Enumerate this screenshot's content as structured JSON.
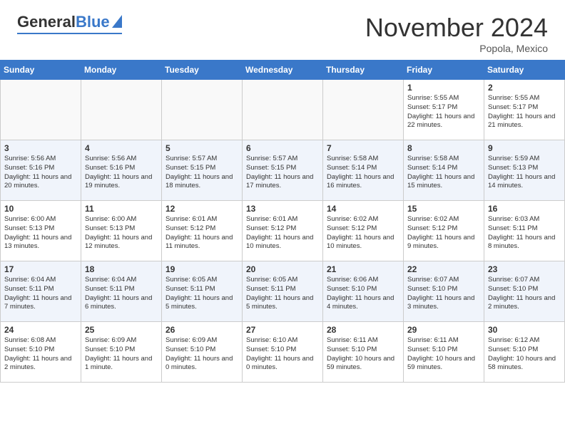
{
  "header": {
    "logo": {
      "general": "General",
      "blue": "Blue"
    },
    "title": "November 2024",
    "subtitle": "Popola, Mexico"
  },
  "weekdays": [
    "Sunday",
    "Monday",
    "Tuesday",
    "Wednesday",
    "Thursday",
    "Friday",
    "Saturday"
  ],
  "weeks": [
    [
      {
        "day": "",
        "empty": true
      },
      {
        "day": "",
        "empty": true
      },
      {
        "day": "",
        "empty": true
      },
      {
        "day": "",
        "empty": true
      },
      {
        "day": "",
        "empty": true
      },
      {
        "day": "1",
        "sunrise": "5:55 AM",
        "sunset": "5:17 PM",
        "daylight": "11 hours and 22 minutes."
      },
      {
        "day": "2",
        "sunrise": "5:55 AM",
        "sunset": "5:17 PM",
        "daylight": "11 hours and 21 minutes."
      }
    ],
    [
      {
        "day": "3",
        "sunrise": "5:56 AM",
        "sunset": "5:16 PM",
        "daylight": "11 hours and 20 minutes."
      },
      {
        "day": "4",
        "sunrise": "5:56 AM",
        "sunset": "5:16 PM",
        "daylight": "11 hours and 19 minutes."
      },
      {
        "day": "5",
        "sunrise": "5:57 AM",
        "sunset": "5:15 PM",
        "daylight": "11 hours and 18 minutes."
      },
      {
        "day": "6",
        "sunrise": "5:57 AM",
        "sunset": "5:15 PM",
        "daylight": "11 hours and 17 minutes."
      },
      {
        "day": "7",
        "sunrise": "5:58 AM",
        "sunset": "5:14 PM",
        "daylight": "11 hours and 16 minutes."
      },
      {
        "day": "8",
        "sunrise": "5:58 AM",
        "sunset": "5:14 PM",
        "daylight": "11 hours and 15 minutes."
      },
      {
        "day": "9",
        "sunrise": "5:59 AM",
        "sunset": "5:13 PM",
        "daylight": "11 hours and 14 minutes."
      }
    ],
    [
      {
        "day": "10",
        "sunrise": "6:00 AM",
        "sunset": "5:13 PM",
        "daylight": "11 hours and 13 minutes."
      },
      {
        "day": "11",
        "sunrise": "6:00 AM",
        "sunset": "5:13 PM",
        "daylight": "11 hours and 12 minutes."
      },
      {
        "day": "12",
        "sunrise": "6:01 AM",
        "sunset": "5:12 PM",
        "daylight": "11 hours and 11 minutes."
      },
      {
        "day": "13",
        "sunrise": "6:01 AM",
        "sunset": "5:12 PM",
        "daylight": "11 hours and 10 minutes."
      },
      {
        "day": "14",
        "sunrise": "6:02 AM",
        "sunset": "5:12 PM",
        "daylight": "11 hours and 10 minutes."
      },
      {
        "day": "15",
        "sunrise": "6:02 AM",
        "sunset": "5:12 PM",
        "daylight": "11 hours and 9 minutes."
      },
      {
        "day": "16",
        "sunrise": "6:03 AM",
        "sunset": "5:11 PM",
        "daylight": "11 hours and 8 minutes."
      }
    ],
    [
      {
        "day": "17",
        "sunrise": "6:04 AM",
        "sunset": "5:11 PM",
        "daylight": "11 hours and 7 minutes."
      },
      {
        "day": "18",
        "sunrise": "6:04 AM",
        "sunset": "5:11 PM",
        "daylight": "11 hours and 6 minutes."
      },
      {
        "day": "19",
        "sunrise": "6:05 AM",
        "sunset": "5:11 PM",
        "daylight": "11 hours and 5 minutes."
      },
      {
        "day": "20",
        "sunrise": "6:05 AM",
        "sunset": "5:11 PM",
        "daylight": "11 hours and 5 minutes."
      },
      {
        "day": "21",
        "sunrise": "6:06 AM",
        "sunset": "5:10 PM",
        "daylight": "11 hours and 4 minutes."
      },
      {
        "day": "22",
        "sunrise": "6:07 AM",
        "sunset": "5:10 PM",
        "daylight": "11 hours and 3 minutes."
      },
      {
        "day": "23",
        "sunrise": "6:07 AM",
        "sunset": "5:10 PM",
        "daylight": "11 hours and 2 minutes."
      }
    ],
    [
      {
        "day": "24",
        "sunrise": "6:08 AM",
        "sunset": "5:10 PM",
        "daylight": "11 hours and 2 minutes."
      },
      {
        "day": "25",
        "sunrise": "6:09 AM",
        "sunset": "5:10 PM",
        "daylight": "11 hours and 1 minute."
      },
      {
        "day": "26",
        "sunrise": "6:09 AM",
        "sunset": "5:10 PM",
        "daylight": "11 hours and 0 minutes."
      },
      {
        "day": "27",
        "sunrise": "6:10 AM",
        "sunset": "5:10 PM",
        "daylight": "11 hours and 0 minutes."
      },
      {
        "day": "28",
        "sunrise": "6:11 AM",
        "sunset": "5:10 PM",
        "daylight": "10 hours and 59 minutes."
      },
      {
        "day": "29",
        "sunrise": "6:11 AM",
        "sunset": "5:10 PM",
        "daylight": "10 hours and 59 minutes."
      },
      {
        "day": "30",
        "sunrise": "6:12 AM",
        "sunset": "5:10 PM",
        "daylight": "10 hours and 58 minutes."
      }
    ]
  ],
  "daylight_label": "Daylight hours",
  "sunrise_label": "Sunrise:",
  "sunset_label": "Sunset:"
}
